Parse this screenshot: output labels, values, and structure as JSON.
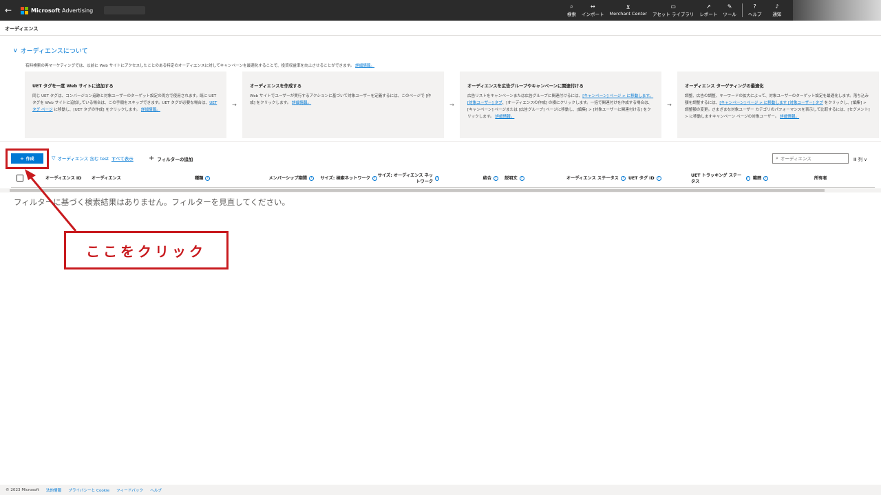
{
  "topbar": {
    "back_icon": "back-arrow-icon",
    "brand_name": "Microsoft",
    "product_name": "Advertising",
    "nav": [
      {
        "label": "検索",
        "icon": "⌕"
      },
      {
        "label": "インポート",
        "icon": "↔"
      },
      {
        "label": "Merchant Center",
        "icon": "🛒"
      },
      {
        "label": "アセット ライブラリ",
        "icon": "▭"
      },
      {
        "label": "レポート",
        "icon": "↗"
      },
      {
        "label": "ツール",
        "icon": "✎"
      },
      {
        "label": "ヘルプ",
        "icon": "?"
      },
      {
        "label": "通知",
        "icon": "🔔"
      }
    ]
  },
  "page": {
    "title": "オーディエンス"
  },
  "about": {
    "header": "オーディエンスについて",
    "description": "有料検索の再マーケティングでは、以前に Web サイトにアクセスしたことのある特定のオーディエンスに対してキャンペーンを最適化することで、投資収益率を向上させることができます。",
    "description_link": "詳細情報。",
    "cards": [
      {
        "title": "UET タグを一度 Web サイトに追加する",
        "body": "同じ UET タグは、コンバージョン追跡と対象ユーザーのターゲット設定の両方で使用されます。既に UET タグを Web サイトに追加している場合は、この手順をスキップできます。UET タグが必要な場合は、",
        "link1": "UET タグ ページ",
        "body2": "に移動し、[UET タグの作成] をクリックします。",
        "link2": "詳細情報。"
      },
      {
        "title": "オーディエンスを作成する",
        "body": "Web サイトでユーザーが実行するアクションに基づいて対象ユーザーを定義するには、このページで [作成] をクリックします。",
        "link1": "詳細情報。"
      },
      {
        "title": "オーディエンスを広告グループやキャンペーンに関連付ける",
        "body": "広告リストをキャンペーンまたは広告グループに関連付けるには、",
        "link1": "[キャンペーン] ページ > に移動します。[対象ユーザー] タブ",
        "body2": "、[オーディエンスの作成] の横にクリックします。一括で関連付けを作成する場合は、[キャンペーン] ページまたは [広告グループ] ページに移動し、[編集] > [対象ユーザーに関連付ける] をクリックします。",
        "link2": "詳細情報。"
      },
      {
        "title": "オーディエンス ターゲティングの最適化",
        "body": "調整、広告の調整、キーワードの拡大によって、対象ユーザーのターゲット設定を最適化します。落ち込み額を調整するには、",
        "link1": "[キャンペーン] ページ > に移動します [対象ユーザー] タブ",
        "body2": "をクリックし、[編集] > 調整額の変更。さまざまな対象ユーザー カテゴリのパフォーマンスを表示して比較するには、[セグメント] > に移動しますキャンペーン ページの対象ユーザー。",
        "link2": "詳細情報。"
      }
    ]
  },
  "toolbar": {
    "create_label": "作成",
    "filter_label": "オーディエンス 含む test",
    "show_all": "すべて表示",
    "add_filter": "フィルターの追加",
    "search_placeholder": "オーディエンス",
    "columns_label": "列"
  },
  "table": {
    "headers": [
      {
        "label": "オーディエンス ID",
        "help": false
      },
      {
        "label": "オーディエンス",
        "help": false
      },
      {
        "label": "種類",
        "help": true
      },
      {
        "label": "メンバーシップ期間",
        "help": true
      },
      {
        "label": "サイズ: 検索ネットワーク",
        "help": true
      },
      {
        "label": "サイズ: オーディエンス ネットワーク",
        "help": true
      },
      {
        "label": "結合",
        "help": true
      },
      {
        "label": "説明文",
        "help": true
      },
      {
        "label": "オーディエンス ステータス",
        "help": true
      },
      {
        "label": "UET タグ ID",
        "help": true
      },
      {
        "label": "UET トラッキング ステータス",
        "help": true
      },
      {
        "label": "範囲",
        "help": true
      },
      {
        "label": "所有者",
        "help": false
      }
    ],
    "empty_message": "フィルターに基づく検索結果はありません。フィルターを見直してください。"
  },
  "annotation": {
    "text": "ここをクリック",
    "color": "#c81a1e"
  },
  "footer": {
    "copyright": "© 2023 Microsoft",
    "links": [
      "法的情報",
      "プライバシーと Cookie",
      "フィードバック",
      "ヘルプ"
    ]
  },
  "colors": {
    "accent": "#0078d4",
    "topbar": "#2b2b2b",
    "annotation": "#c81a1e"
  }
}
